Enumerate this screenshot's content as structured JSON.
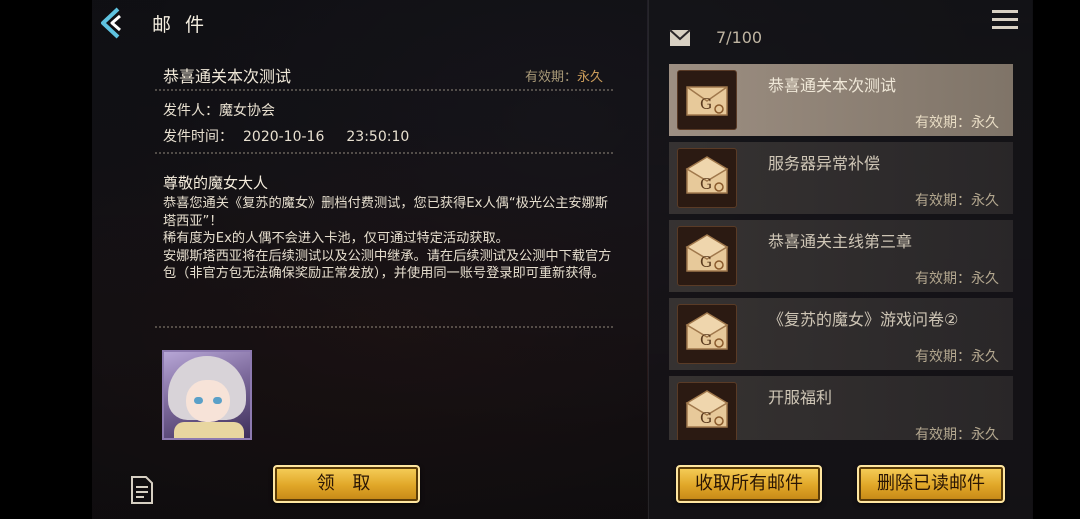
{
  "header": {
    "title": "邮 件"
  },
  "detail": {
    "subject": "恭喜通关本次测试",
    "validity_label": "有效期：",
    "validity_value": "永久",
    "sender": "发件人：魔女协会",
    "send_time_label": "发件时间：",
    "send_date": "2020-10-16",
    "send_clock": "23:50:10",
    "greeting": "尊敬的魔女大人",
    "body": [
      "恭喜您通关《复苏的魔女》删档付费测试，您已获得Ex人偶“极光公主安娜斯塔西亚”！",
      "稀有度为Ex的人偶不会进入卡池，仅可通过特定活动获取。",
      "安娜斯塔西亚将在后续测试以及公测中继承。请在后续测试及公测中下载官方包（非官方包无法确保奖励正常发放），并使用同一账号登录即可重新获得。"
    ],
    "claim_button": "领 取"
  },
  "inbox": {
    "count": "7/100",
    "items": [
      {
        "title": "恭喜通关本次测试",
        "validity": "有效期：永久",
        "selected": true
      },
      {
        "title": "服务器异常补偿",
        "validity": "有效期：永久",
        "selected": false
      },
      {
        "title": "恭喜通关主线第三章",
        "validity": "有效期：永久",
        "selected": false
      },
      {
        "title": "《复苏的魔女》游戏问卷②",
        "validity": "有效期：永久",
        "selected": false
      },
      {
        "title": "开服福利",
        "validity": "有效期：永久",
        "selected": false
      }
    ],
    "collect_all_button": "收取所有邮件",
    "delete_read_button": "删除已读邮件"
  },
  "colors": {
    "accent_gold": "#e0a627",
    "selected_item": "#9d8f82",
    "validity_value": "#c99b5a"
  },
  "icons": [
    "back-arrow-icon",
    "mail-icon",
    "menu-icon",
    "notes-icon",
    "envelope-icon"
  ]
}
